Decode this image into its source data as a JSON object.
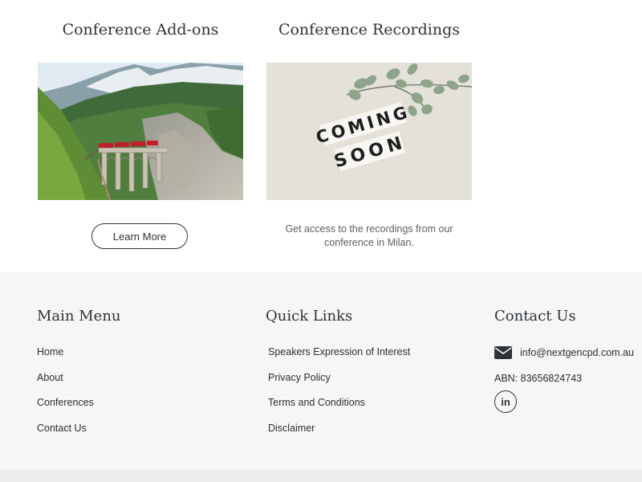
{
  "addons": {
    "title": "Conference Add-ons",
    "button_label": "Learn More",
    "image": "alpine-train-viaduct-photo"
  },
  "recordings": {
    "title": "Conference Recordings",
    "image_word1": "COMING",
    "image_word2": "SOON",
    "description": "Get access to the recordings from our conference in Milan."
  },
  "footer": {
    "main_menu": {
      "heading": "Main Menu",
      "items": [
        "Home",
        "About",
        "Conferences",
        "Contact Us"
      ]
    },
    "quick_links": {
      "heading": "Quick Links",
      "items": [
        "Speakers Expression of Interest",
        "Privacy Policy",
        "Terms and Conditions",
        "Disclaimer"
      ]
    },
    "contact": {
      "heading": "Contact Us",
      "email": "info@nextgencpd.com.au",
      "abn": "ABN: 83656824743",
      "linkedin_icon": "linkedin-icon",
      "linkedin_glyph": "in",
      "email_icon": "envelope-icon"
    }
  },
  "colors": {
    "text": "#2d3338",
    "footer_bg": "#f6f6f6",
    "body_bg": "#ffffff"
  }
}
